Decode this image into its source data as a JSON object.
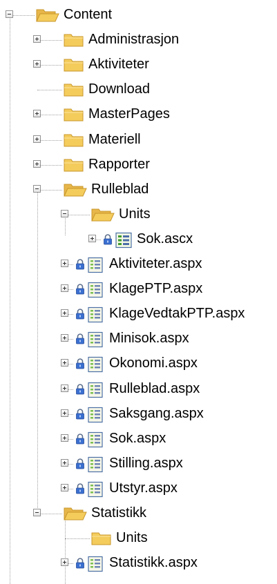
{
  "tree": {
    "nodes": [
      {
        "label": "Content",
        "icon": "folder-open-icon",
        "expander": "minus"
      },
      {
        "label": "Administrasjon",
        "icon": "folder-icon",
        "expander": "plus"
      },
      {
        "label": "Aktiviteter",
        "icon": "folder-icon",
        "expander": "plus"
      },
      {
        "label": "Download",
        "icon": "folder-icon",
        "expander": "none"
      },
      {
        "label": "MasterPages",
        "icon": "folder-icon",
        "expander": "plus"
      },
      {
        "label": "Materiell",
        "icon": "folder-icon",
        "expander": "plus"
      },
      {
        "label": "Rapporter",
        "icon": "folder-icon",
        "expander": "plus"
      },
      {
        "label": "Rulleblad",
        "icon": "folder-open-icon",
        "expander": "minus"
      },
      {
        "label": "Units",
        "icon": "folder-open-icon",
        "expander": "minus"
      },
      {
        "label": "Sok.ascx",
        "icon": "user-control-file-icon",
        "expander": "plus",
        "locked": true
      },
      {
        "label": "Aktiviteter.aspx",
        "icon": "web-form-file-icon",
        "expander": "plus",
        "locked": true
      },
      {
        "label": "KlagePTP.aspx",
        "icon": "web-form-file-icon",
        "expander": "plus",
        "locked": true
      },
      {
        "label": "KlageVedtakPTP.aspx",
        "icon": "web-form-file-icon",
        "expander": "plus",
        "locked": true
      },
      {
        "label": "Minisok.aspx",
        "icon": "web-form-file-icon",
        "expander": "plus",
        "locked": true
      },
      {
        "label": "Okonomi.aspx",
        "icon": "web-form-file-icon",
        "expander": "plus",
        "locked": true
      },
      {
        "label": "Rulleblad.aspx",
        "icon": "web-form-file-icon",
        "expander": "plus",
        "locked": true
      },
      {
        "label": "Saksgang.aspx",
        "icon": "web-form-file-icon",
        "expander": "plus",
        "locked": true
      },
      {
        "label": "Sok.aspx",
        "icon": "web-form-file-icon",
        "expander": "plus",
        "locked": true
      },
      {
        "label": "Stilling.aspx",
        "icon": "web-form-file-icon",
        "expander": "plus",
        "locked": true
      },
      {
        "label": "Utstyr.aspx",
        "icon": "web-form-file-icon",
        "expander": "plus",
        "locked": true
      },
      {
        "label": "Statistikk",
        "icon": "folder-open-icon",
        "expander": "minus"
      },
      {
        "label": "Units",
        "icon": "folder-icon",
        "expander": "none"
      },
      {
        "label": "Statistikk.aspx",
        "icon": "web-form-file-icon",
        "expander": "plus",
        "locked": true
      }
    ]
  },
  "colors": {
    "folder": "#f4cc5c",
    "folder_edge": "#c8962a",
    "lock": "#3a6fd0",
    "file_border": "#4a6fa5",
    "tree_line": "#a0a0a0"
  }
}
